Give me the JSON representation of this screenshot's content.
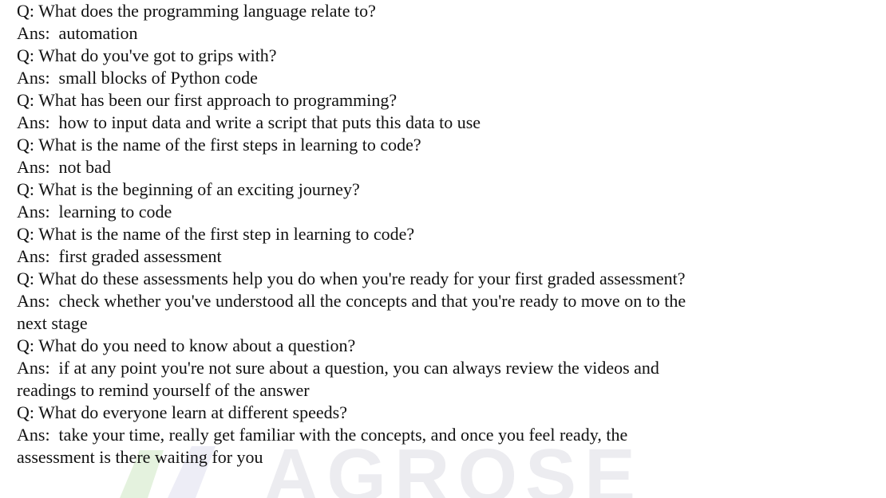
{
  "qa": [
    {
      "q": "Q: What does the programming language relate to?",
      "a": "Ans:  automation"
    },
    {
      "q": "Q: What do you've got to grips with?",
      "a": "Ans:  small blocks of Python code"
    },
    {
      "q": "Q: What has been our first approach to programming?",
      "a": "Ans:  how to input data and write a script that puts this data to use"
    },
    {
      "q": "Q: What is the name of the first steps in learning to code?",
      "a": "Ans:  not bad"
    },
    {
      "q": "Q: What is the beginning of an exciting journey?",
      "a": "Ans:  learning to code"
    },
    {
      "q": "Q: What is the name of the first step in learning to code?",
      "a": "Ans:  first graded assessment"
    },
    {
      "q": "Q: What do these assessments help you do when you're ready for your first graded assessment?",
      "a": "Ans:  check whether you've understood all the concepts and that you're ready to move on to the",
      "a2": "next stage"
    },
    {
      "q": "Q: What do you need to know about a question?",
      "a": "Ans:  if at any point you're not sure about a question, you can always review the videos and",
      "a2": "readings to remind yourself of the answer"
    },
    {
      "q": "Q: What do everyone learn at different speeds?",
      "a": "Ans:  take your time, really get familiar with the concepts, and once you feel ready, the",
      "a2": "assessment is there waiting for you"
    }
  ],
  "watermark": {
    "text": "AGROSE",
    "color": "#e9e9ee",
    "accent_color": "#d8ecd0"
  }
}
